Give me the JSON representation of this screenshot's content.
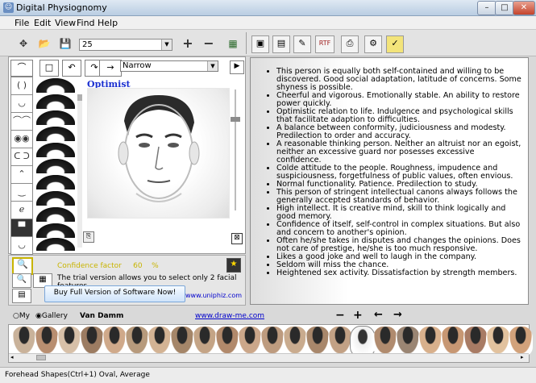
{
  "window": {
    "title": "Digital Physiognomy",
    "icon": "app-icon"
  },
  "menu": [
    "File",
    "Edit",
    "View",
    "Find",
    "Help"
  ],
  "toolbar": {
    "zoom_value": "25",
    "left_icons": [
      "move-icon",
      "open-icon",
      "save-icon"
    ],
    "zoom_icons": [
      "zoom-in-icon",
      "zoom-out-icon",
      "export-icon"
    ],
    "right_icons": [
      "report-icon",
      "document-icon",
      "edit-icon",
      "rtf-icon",
      "print-icon",
      "settings-icon",
      "note-icon"
    ]
  },
  "editor": {
    "face_label": "Optimist",
    "style_select": "Narrow",
    "feature_icons": [
      "face-shape-icon",
      "forehead-icon",
      "eyebrow-icon",
      "eye-icon",
      "ear-icon",
      "nose-icon",
      "mouth-icon",
      "cheek-icon",
      "chin-icon",
      "jaw-icon",
      "hair-icon"
    ]
  },
  "info": {
    "confidence_label": "Confidence factor",
    "confidence_value": "60",
    "confidence_unit": "%",
    "trial_text": "The trial version allows you to select only 2 facial features",
    "buy_button": "Buy Full Version of Software Now!",
    "site_link": "www.uniphiz.com"
  },
  "analysis": [
    "This person is equally both self-contained and willing to be discovered. Good social adaptation, latitude of concerns. Some shyness is possible.",
    "Cheerful and vigorous. Emotionally stable. An ability to restore power quickly.",
    "Optimistic relation to life. Indulgence and psychological skills that facilitate adaption to difficulties.",
    "A balance between conformity, judiciousness and modesty. Predilection to order and accuracy.",
    "A reasonable thinking person. Neither an altruist nor an egoist, neither an excessive guard nor posesses excessive confidence.",
    "Colde attitude to the people. Roughness, impudence and suspiciousness, forgetfulness of public values, often envious.",
    "Normal functionality. Patience. Predilection to study.",
    "This person of stringent intellectual canons always follows the generally accepted standards of behavior.",
    "High intellect. It is creative mind, skill to think logically and good memory.",
    "Confidence of itself, self-control in complex situations. But also and concern to another's opinion.",
    "Often he/she takes in disputes and changes the opinions. Does not care of prestige, he/she is too much responsive.",
    "Likes a good joke and well to laugh in the company.",
    "Seldom will miss the chance.",
    "Heightened sex activity. Dissatisfaction by strength members."
  ],
  "gallery": {
    "radio_my": "My",
    "radio_gallery": "Gallery",
    "selected_name": "Van Damm",
    "link": "www.draw-me.com",
    "thumb_colors": [
      "#c9b29a",
      "#b88e70",
      "#d7c0a8",
      "#9c7c62",
      "#cfa98a",
      "#b79a7c",
      "#d3b394",
      "#a58669",
      "#c4a486",
      "#b1896b",
      "#cba78a",
      "#bd9b7f",
      "#c9ab8e",
      "#a8876b",
      "#c2a185",
      "#dcdcdc",
      "#b08b6e",
      "#9a8573",
      "#d8b08c",
      "#c79773",
      "#a87b64",
      "#e2c29e",
      "#d2a27b"
    ]
  },
  "status": "Forehead Shapes(Ctrl+1) Oval, Average"
}
